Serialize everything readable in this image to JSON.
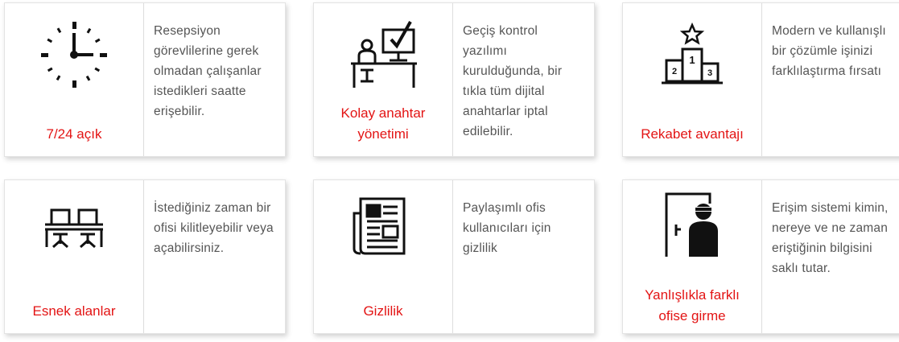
{
  "cards": [
    {
      "title": "7/24 açık",
      "description": "Resepsiyon görevlilerine gerek olmadan çalışanlar istedikleri saatte erişebilir.",
      "icon": "clock-icon"
    },
    {
      "title": "Kolay anahtar yönetimi",
      "description": "Geçiş kontrol yazılımı kurulduğunda, bir tıkla tüm dijital anahtarlar iptal edilebilir.",
      "icon": "desk-computer-check-icon"
    },
    {
      "title": "Rekabet avantajı",
      "description": "Modern ve kullanışlı bir çözümle işinizi farklılaştırma fırsatı",
      "icon": "podium-star-icon"
    },
    {
      "title": "Esnek alanlar",
      "description": "İstediğiniz zaman bir ofisi kilitleyebilir veya açabilirsiniz.",
      "icon": "shared-desks-icon"
    },
    {
      "title": "Gizlilik",
      "description": "Paylaşımlı ofis kullanıcıları için gizlilik",
      "icon": "newspaper-icon"
    },
    {
      "title": "Yanlışlıkla farklı ofise girme",
      "description": "Erişim sistemi kimin, nereye ve ne zaman eriştiğinin bilgisini saklı tutar.",
      "icon": "door-intruder-icon"
    }
  ],
  "colors": {
    "title": "#e31414",
    "text": "#555555",
    "border": "#dddddd"
  }
}
